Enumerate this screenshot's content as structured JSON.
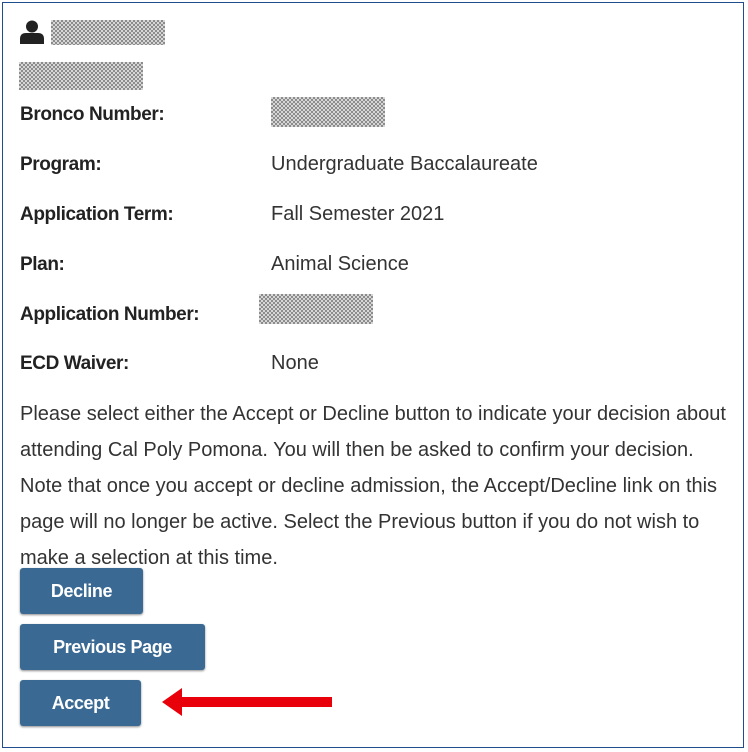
{
  "fields": [
    {
      "label": "Bronco Number:",
      "value": ""
    },
    {
      "label": "Program:",
      "value": "Undergraduate Baccalaureate"
    },
    {
      "label": "Application Term:",
      "value": "Fall Semester 2021"
    },
    {
      "label": "Plan:",
      "value": "Animal Science"
    },
    {
      "label": "Application Number:",
      "value": ""
    },
    {
      "label": "ECD Waiver:",
      "value": "None"
    }
  ],
  "instructions": "Please select either the Accept or Decline button to indicate your decision about attending Cal Poly Pomona. You will then be asked to confirm your decision. Note that once you accept or decline admission, the Accept/Decline link on this page will no longer be active. Select the Previous button if you do not wish to make a selection at this time.",
  "buttons": {
    "decline": "Decline",
    "previous": "Previous Page",
    "accept": "Accept"
  },
  "colors": {
    "button": "#3a6a94",
    "frame_border": "#1f4e8c",
    "annotation_arrow": "#e8000b"
  },
  "icons": {
    "user": "user-icon",
    "annotation": "arrow-left-icon"
  }
}
